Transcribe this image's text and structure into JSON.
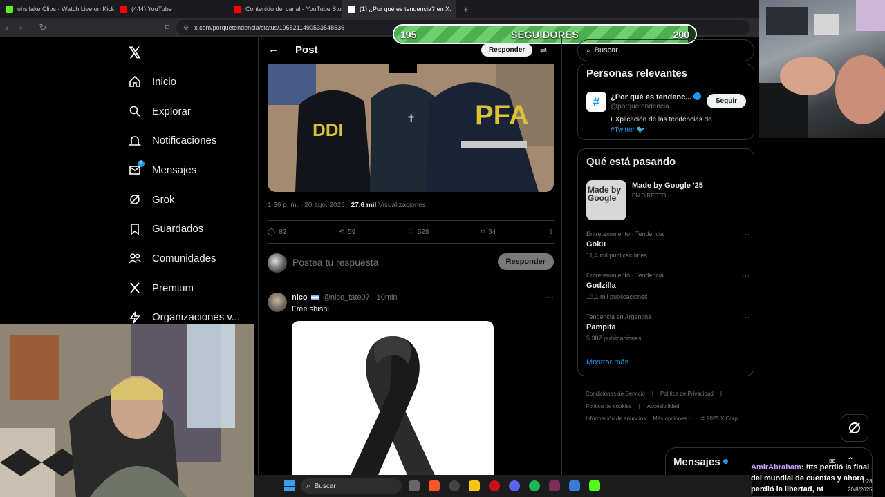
{
  "browser": {
    "tabs": [
      {
        "title": "ohsifake Clips - Watch Live on Kick",
        "color": "#53fc18",
        "active": false
      },
      {
        "title": "(444) YouTube",
        "color": "#ff0000",
        "active": false
      },
      {
        "title": "Contenido del canal - YouTube Studi",
        "color": "#ff0000",
        "active": false
      },
      {
        "title": "(1) ¿Por qué es tendencia? en X:",
        "color": "#ffffff",
        "active": true
      }
    ],
    "url": "x.com/porquetendencia/status/1958211490533548536"
  },
  "followers_goal": {
    "label": "SEGUIDORES",
    "current": "195",
    "target": "200",
    "progress": 0.975
  },
  "sidebar": {
    "items": [
      {
        "label": "Inicio",
        "icon": "home-icon"
      },
      {
        "label": "Explorar",
        "icon": "search-icon"
      },
      {
        "label": "Notificaciones",
        "icon": "bell-icon"
      },
      {
        "label": "Mensajes",
        "icon": "mail-icon",
        "badge": "1"
      },
      {
        "label": "Grok",
        "icon": "grok-icon"
      },
      {
        "label": "Guardados",
        "icon": "bookmark-icon"
      },
      {
        "label": "Comunidades",
        "icon": "people-icon"
      },
      {
        "label": "Premium",
        "icon": "x-icon"
      },
      {
        "label": "Organizaciones v...",
        "icon": "bolt-icon"
      }
    ]
  },
  "post": {
    "header_title": "Post",
    "reply_top": "Responder",
    "photo_labels": {
      "left": "DDI",
      "right": "PFA"
    },
    "time": "1:56 p. m. · 20 ago. 2025 ·",
    "views_count": "27,6 mil",
    "views_label": "Visualizaciones",
    "stats": {
      "replies": "82",
      "reposts": "59",
      "likes": "528",
      "bookmarks": "34"
    },
    "reply_placeholder": "Postea tu respuesta",
    "reply_button": "Responder"
  },
  "reply": {
    "name": "nico",
    "handle": "@nico_tate07",
    "time": "· 10min",
    "text": "Free shishi",
    "more": "···"
  },
  "right": {
    "search_placeholder": "Buscar",
    "relevant": {
      "title": "Personas relevantes",
      "name": "¿Por qué es tendenc...",
      "handle": "@porquetendencia",
      "bio": "EXplicación de las tendencias de",
      "bio_link": "#Twitter",
      "follow": "Seguir"
    },
    "trends": {
      "title": "Qué está pasando",
      "featured": {
        "name": "Made by Google '25",
        "status": "EN DIRECTO",
        "thumb": "Made by Google"
      },
      "items": [
        {
          "category": "Entretenimiento · Tendencia",
          "name": "Goku",
          "count": "11,4 mil publicaciones"
        },
        {
          "category": "Entretenimiento · Tendencia",
          "name": "Godzilla",
          "count": "10,1 mil publicaciones"
        },
        {
          "category": "Tendencia en Argentina",
          "name": "Pampita",
          "count": "5.387 publicaciones"
        }
      ],
      "show_more": "Mostrar más"
    },
    "footer": [
      "Condiciones de Servicio",
      "|",
      "Política de Privacidad",
      "|",
      "Política de cookies",
      "|",
      "Accesibilidad",
      "|",
      "Información de anuncios",
      "Más opciones ···",
      "© 2025 X Corp."
    ]
  },
  "messages_drawer": {
    "title": "Mensajes"
  },
  "chat": {
    "user": "AmirAbraham",
    "text": ": !tts perdió la final del mundial de cuentas y ahora perdió la libertad, nt"
  },
  "clock": {
    "time": "1:28",
    "date": "20/8/2025"
  },
  "taskbar": {
    "search": "Buscar"
  }
}
